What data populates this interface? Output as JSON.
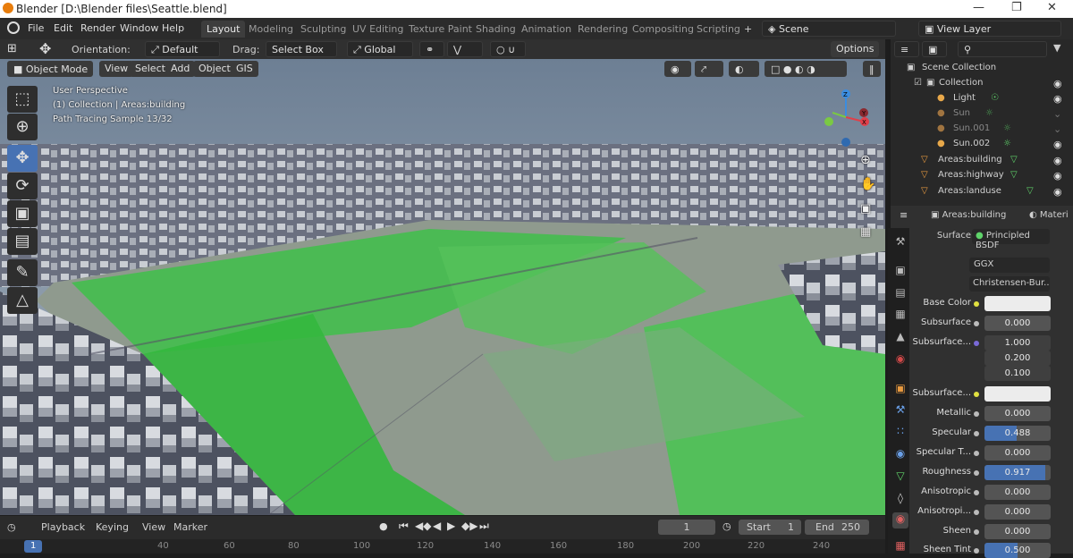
{
  "titlebar": {
    "title": "Blender [D:\\Blender files\\Seattle.blend]",
    "minimize": "—",
    "maximize": "❐",
    "close": "✕"
  },
  "menu": [
    "File",
    "Edit",
    "Render",
    "Window",
    "Help"
  ],
  "workspaces": [
    "Layout",
    "Modeling",
    "Sculpting",
    "UV Editing",
    "Texture Paint",
    "Shading",
    "Animation",
    "Rendering",
    "Compositing",
    "Scripting"
  ],
  "add_workspace": "+",
  "scene": "Scene",
  "view_layer": "View Layer",
  "toolbar": {
    "orientation_label": "Orientation:",
    "orientation_value": "Default",
    "drag_label": "Drag:",
    "drag_value": "Select Box",
    "transform_value": "Global",
    "options": "Options"
  },
  "viewport_header": {
    "mode": "Object Mode",
    "menus": [
      "View",
      "Select",
      "Add",
      "Object",
      "GIS"
    ]
  },
  "overlay": {
    "line1": "User Perspective",
    "line2": "(1) Collection | Areas:building",
    "line3": "Path Tracing Sample 13/32"
  },
  "gizmo": {
    "z": "Z",
    "x": "X",
    "y": "Y"
  },
  "outliner": {
    "search_placeholder": "",
    "items": [
      {
        "label": "Scene Collection"
      },
      {
        "label": "Collection"
      },
      {
        "label": "Light"
      },
      {
        "label": "Sun"
      },
      {
        "label": "Sun.001"
      },
      {
        "label": "Sun.002"
      },
      {
        "label": "Areas:building"
      },
      {
        "label": "Areas:highway"
      },
      {
        "label": "Areas:landuse"
      }
    ]
  },
  "properties": {
    "object": "Areas:building",
    "material_tab": "Materi",
    "surface_label": "Surface",
    "surface_value": "Principled BSDF",
    "distribution": "GGX",
    "subsurface_method": "Christensen-Bur...",
    "rows": [
      {
        "label": "Base Color",
        "value": ""
      },
      {
        "label": "Subsurface",
        "value": "0.000"
      },
      {
        "label": "Subsurface...",
        "value": "1.000"
      },
      {
        "label": "",
        "value": "0.200"
      },
      {
        "label": "",
        "value": "0.100"
      },
      {
        "label": "Subsurface...",
        "value": ""
      },
      {
        "label": "Metallic",
        "value": "0.000"
      },
      {
        "label": "Specular",
        "value": "0.488"
      },
      {
        "label": "Specular T...",
        "value": "0.000"
      },
      {
        "label": "Roughness",
        "value": "0.917"
      },
      {
        "label": "Anisotropic",
        "value": "0.000"
      },
      {
        "label": "Anisotropi...",
        "value": "0.000"
      },
      {
        "label": "Sheen",
        "value": "0.000"
      },
      {
        "label": "Sheen Tint",
        "value": "0.500"
      }
    ]
  },
  "timeline": {
    "menus": [
      "Playback",
      "Keying",
      "View",
      "Marker"
    ],
    "current_frame": "1",
    "start_label": "Start",
    "start": "1",
    "end_label": "End",
    "end": "250",
    "ticks": [
      "1",
      "40",
      "60",
      "80",
      "100",
      "120",
      "140",
      "160",
      "180",
      "200",
      "220",
      "240"
    ]
  },
  "colors": {
    "accent": "#4772b3",
    "green": "#3cc93c"
  }
}
